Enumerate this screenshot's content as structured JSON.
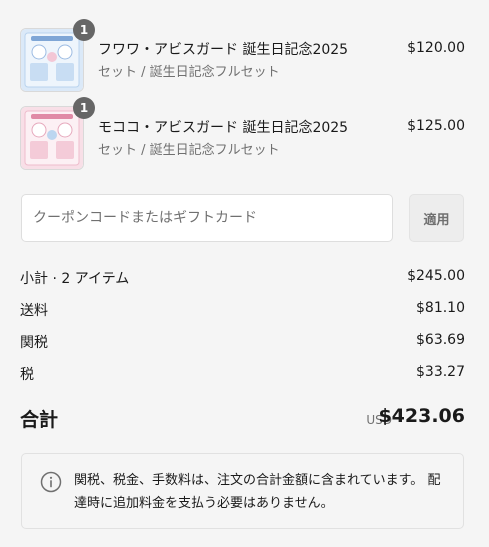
{
  "items": [
    {
      "title": "フワワ・アビスガード 誕生日記念2025",
      "variant": "セット / 誕生日記念フルセット",
      "price": "$120.00",
      "quantity": "1",
      "thumbnail_icon": "product-thumbnail-blue-card",
      "thumb_color": "#cfe3f6"
    },
    {
      "title": "モココ・アビスガード 誕生日記念2025",
      "variant": "セット / 誕生日記念フルセット",
      "price": "$125.00",
      "quantity": "1",
      "thumbnail_icon": "product-thumbnail-pink-card",
      "thumb_color": "#f6d3df"
    }
  ],
  "coupon": {
    "placeholder": "クーポンコードまたはギフトカード",
    "value": "",
    "apply_label": "適用"
  },
  "summary": {
    "subtotal_label": "小計 · 2 アイテム",
    "subtotal_value": "$245.00",
    "shipping_label": "送料",
    "shipping_value": "$81.10",
    "duties_label": "関税",
    "duties_value": "$63.69",
    "tax_label": "税",
    "tax_value": "$33.27"
  },
  "total": {
    "label": "合計",
    "currency": "USD",
    "value": "$423.06"
  },
  "notice": {
    "icon": "info-icon",
    "text": "関税、税金、手数料は、注文の合計金額に含まれています。 配達時に追加料金を支払う必要はありません。"
  }
}
